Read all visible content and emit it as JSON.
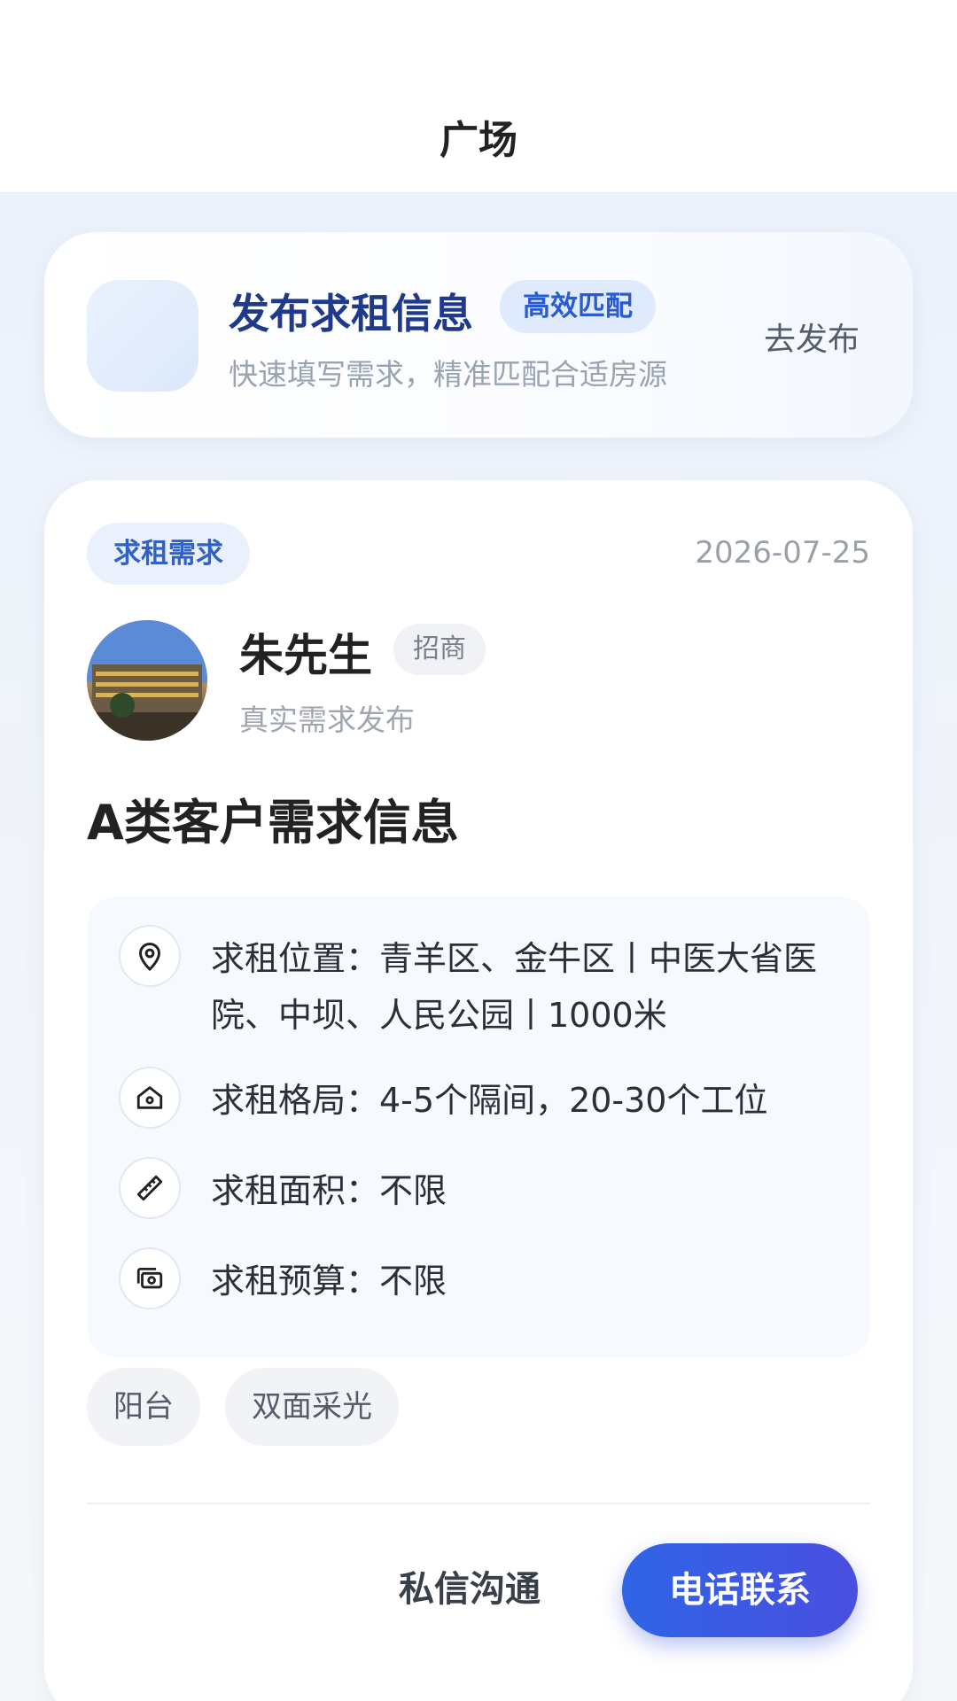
{
  "header": {
    "title": "广场"
  },
  "publish_card": {
    "title": "发布求租信息",
    "badge": "高效匹配",
    "subtitle": "快速填写需求，精准匹配合适房源",
    "action": "去发布"
  },
  "post": {
    "tag": "求租需求",
    "date": "2026-07-25",
    "user": {
      "name": "朱先生",
      "role": "招商",
      "subtitle": "真实需求发布"
    },
    "title": "A类客户需求信息",
    "details": [
      {
        "icon": "location-pin-icon",
        "text": "求租位置：青羊区、金牛区丨中医大省医院、中坝、人民公园丨1000米"
      },
      {
        "icon": "home-icon",
        "text": "求租格局：4-5个隔间，20-30个工位"
      },
      {
        "icon": "ruler-icon",
        "text": "求租面积：不限"
      },
      {
        "icon": "money-icon",
        "text": "求租预算：不限"
      }
    ],
    "features": [
      "阳台",
      "双面采光"
    ],
    "actions": {
      "message": "私信沟通",
      "call": "电话联系"
    }
  }
}
